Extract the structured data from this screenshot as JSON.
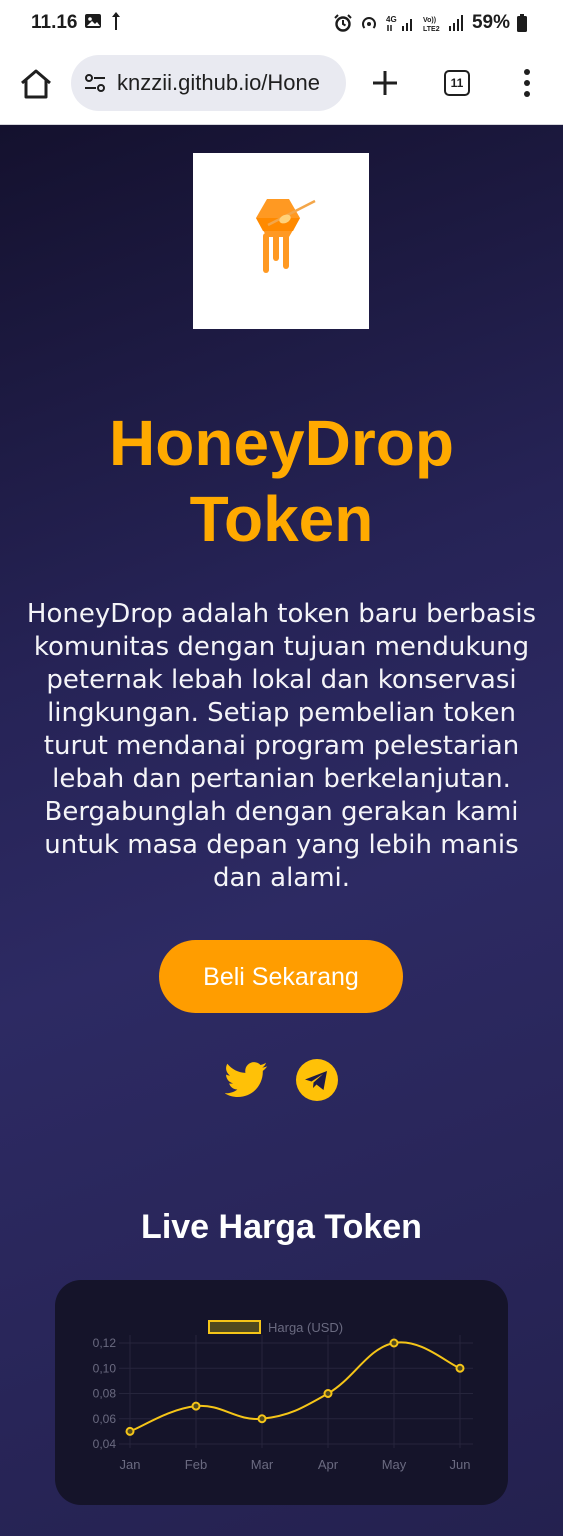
{
  "status_bar": {
    "time": "11.16",
    "battery": "59%",
    "network_4g": "4G",
    "volte": "Vo)) LTE2"
  },
  "browser": {
    "url": "knzzii.github.io/Hone",
    "tab_count": "11"
  },
  "hero": {
    "title_line1": "HoneyDrop",
    "title_line2": "Token",
    "description": "HoneyDrop adalah token baru berbasis komunitas dengan tujuan mendukung peternak lebah lokal dan konservasi lingkungan. Setiap pembelian token turut mendanai program pelestarian lebah dan pertanian berkelanjutan. Bergabunglah dengan gerakan kami untuk masa depan yang lebih manis dan alami.",
    "buy_button": "Beli Sekarang"
  },
  "social": {
    "twitter_icon": "twitter-icon",
    "telegram_icon": "telegram-icon"
  },
  "price_section": {
    "title": "Live Harga Token"
  },
  "colors": {
    "accent": "#ffaa00",
    "button": "#ff9d00",
    "line": "#f5c518"
  },
  "chart_data": {
    "type": "line",
    "categories": [
      "Jan",
      "Feb",
      "Mar",
      "Apr",
      "May",
      "Jun"
    ],
    "series": [
      {
        "name": "Harga (USD)",
        "values": [
          0.05,
          0.07,
          0.06,
          0.08,
          0.12,
          0.1
        ]
      }
    ],
    "y_ticks": [
      "0,04",
      "0,06",
      "0,08",
      "0,10",
      "0,12"
    ],
    "ylim": [
      0.04,
      0.12
    ],
    "grid": true,
    "legend": "top"
  }
}
